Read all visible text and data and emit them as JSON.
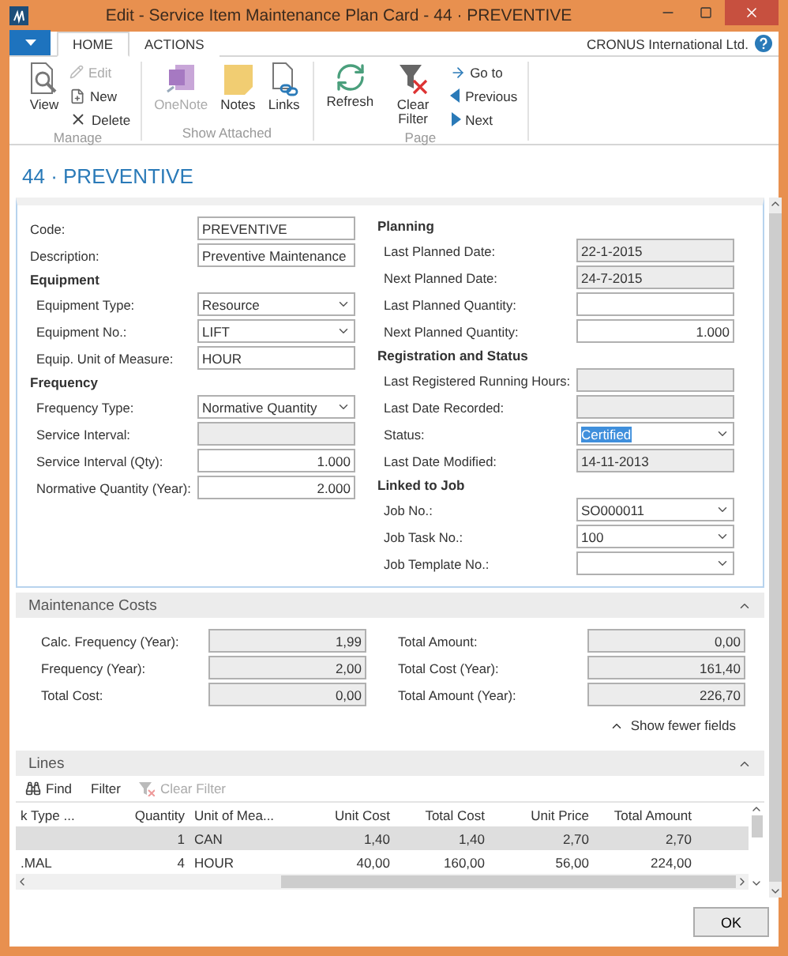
{
  "window": {
    "title": "Edit - Service Item Maintenance Plan Card - 44 · PREVENTIVE"
  },
  "ribbon": {
    "tabs": [
      {
        "label": "HOME",
        "selected": true
      },
      {
        "label": "ACTIONS",
        "selected": false
      }
    ],
    "company": "CRONUS International Ltd.",
    "groups": [
      {
        "label": "Manage",
        "actions": [
          {
            "label": "View",
            "kind": "large",
            "disabled": false
          },
          {
            "label": "Edit",
            "kind": "small",
            "disabled": true
          },
          {
            "label": "New",
            "kind": "small",
            "disabled": false
          },
          {
            "label": "Delete",
            "kind": "small",
            "disabled": false
          }
        ]
      },
      {
        "label": "Show Attached",
        "actions": [
          {
            "label": "OneNote",
            "kind": "large",
            "disabled": true
          },
          {
            "label": "Notes",
            "kind": "large",
            "disabled": false
          },
          {
            "label": "Links",
            "kind": "large",
            "disabled": false
          }
        ]
      },
      {
        "label": "Page",
        "actions": [
          {
            "label": "Refresh",
            "kind": "large",
            "disabled": false
          },
          {
            "label": "Clear Filter",
            "kind": "large",
            "disabled": false
          },
          {
            "label": "Go to",
            "kind": "small",
            "disabled": false
          },
          {
            "label": "Previous",
            "kind": "small",
            "disabled": false
          },
          {
            "label": "Next",
            "kind": "small",
            "disabled": false
          }
        ]
      }
    ]
  },
  "page_title": "44 · PREVENTIVE",
  "general": {
    "expanded": true,
    "left": [
      {
        "kind": "text_field",
        "label": "Code:",
        "value": "PREVENTIVE",
        "editable": true,
        "numeric": false
      },
      {
        "kind": "text_field",
        "label": "Description:",
        "value": "Preventive Maintenance",
        "editable": true,
        "numeric": false
      },
      {
        "kind": "group",
        "label": "Equipment",
        "children": [
          {
            "kind": "dropdown",
            "label": "Equipment Type:",
            "value": "Resource",
            "editable": true
          },
          {
            "kind": "dropdown",
            "label": "Equipment No.:",
            "value": "LIFT",
            "editable": true
          },
          {
            "kind": "text_field",
            "label": "Equip. Unit of Measure:",
            "value": "HOUR",
            "editable": true,
            "numeric": false
          }
        ]
      },
      {
        "kind": "group",
        "label": "Frequency",
        "children": [
          {
            "kind": "dropdown",
            "label": "Frequency Type:",
            "value": "Normative Quantity",
            "editable": true
          },
          {
            "kind": "text_field",
            "label": "Service Interval:",
            "editable": false
          },
          {
            "kind": "text_field",
            "label": "Service Interval (Qty):",
            "value": "1.000",
            "editable": true,
            "numeric": true
          },
          {
            "kind": "text_field",
            "label": "Normative Quantity (Year):",
            "value": "2.000",
            "editable": true,
            "numeric": true
          }
        ]
      }
    ],
    "right": [
      {
        "kind": "group",
        "label": "Planning",
        "children": [
          {
            "kind": "text_field",
            "label": "Last Planned Date:",
            "value": "22-1-2015",
            "editable": false,
            "numeric": false
          },
          {
            "kind": "text_field",
            "label": "Next Planned Date:",
            "value": "24-7-2015",
            "editable": false,
            "numeric": false
          },
          {
            "kind": "text_field",
            "label": "Last Planned Quantity:",
            "editable": true
          },
          {
            "kind": "text_field",
            "label": "Next Planned Quantity:",
            "value": "1.000",
            "editable": true,
            "numeric": true
          }
        ]
      },
      {
        "kind": "group",
        "label": "Registration and Status",
        "children": [
          {
            "kind": "text_field",
            "label": "Last Registered Running Hours:",
            "editable": false
          },
          {
            "kind": "text_field",
            "label": "Last Date Recorded:",
            "editable": false
          },
          {
            "kind": "dropdown",
            "label": "Status:",
            "value": "Certified",
            "editable": true,
            "text_selected": true
          },
          {
            "kind": "text_field",
            "label": "Last Date Modified:",
            "value": "14-11-2013",
            "editable": false,
            "numeric": false
          }
        ]
      },
      {
        "kind": "group",
        "label": "Linked to Job",
        "children": [
          {
            "kind": "dropdown",
            "label": "Job No.:",
            "value": "SO000011",
            "editable": true
          },
          {
            "kind": "dropdown",
            "label": "Job Task No.:",
            "value": "100",
            "editable": true
          },
          {
            "kind": "dropdown",
            "label": "Job Template No.:",
            "editable": true
          }
        ]
      }
    ]
  },
  "maintenance_costs": {
    "title": "Maintenance Costs",
    "expanded": true,
    "left": [
      {
        "kind": "text_field",
        "label": "Calc. Frequency (Year):",
        "value": "1,99",
        "editable": false,
        "numeric": true
      },
      {
        "kind": "text_field",
        "label": "Frequency (Year):",
        "value": "2,00",
        "editable": false,
        "numeric": true
      },
      {
        "kind": "text_field",
        "label": "Total Cost:",
        "value": "0,00",
        "editable": false,
        "numeric": true
      }
    ],
    "right": [
      {
        "kind": "text_field",
        "label": "Total Amount:",
        "value": "0,00",
        "editable": false,
        "numeric": true
      },
      {
        "kind": "text_field",
        "label": "Total Cost (Year):",
        "value": "161,40",
        "editable": false,
        "numeric": true
      },
      {
        "kind": "text_field",
        "label": "Total Amount (Year):",
        "value": "226,70",
        "editable": false,
        "numeric": true
      }
    ],
    "toggle": "Show fewer fields"
  },
  "lines": {
    "title": "Lines",
    "expanded": true,
    "toolbar": [
      {
        "label": "Find",
        "disabled": false
      },
      {
        "label": "Filter",
        "disabled": false
      },
      {
        "label": "Clear Filter",
        "disabled": true
      }
    ],
    "columns": [
      {
        "label": "k Type ...",
        "numeric": false
      },
      {
        "label": "Quantity",
        "numeric": true
      },
      {
        "label": "Unit of Mea...",
        "numeric": false
      },
      {
        "label": "Unit Cost",
        "numeric": true
      },
      {
        "label": "Total Cost",
        "numeric": true
      },
      {
        "label": "Unit Price",
        "numeric": true
      },
      {
        "label": "Total Amount",
        "numeric": true
      }
    ],
    "rows": [
      {
        "selected": true,
        "cells": [
          "",
          "1",
          "CAN",
          "1,40",
          "1,40",
          "2,70",
          "2,70"
        ]
      },
      {
        "selected": false,
        "cells": [
          ".MAL",
          "4",
          "HOUR",
          "40,00",
          "160,00",
          "56,00",
          "224,00"
        ]
      }
    ]
  },
  "buttons": [
    "OK"
  ]
}
